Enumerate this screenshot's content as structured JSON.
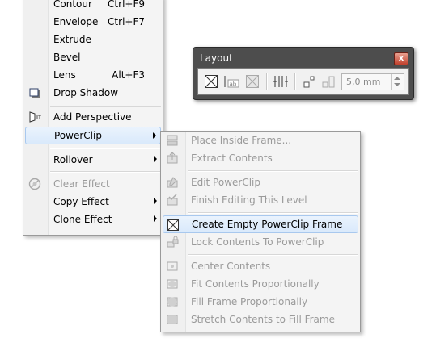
{
  "effects_menu": {
    "items": [
      {
        "label": "Contour",
        "shortcut": "Ctrl+F9"
      },
      {
        "label": "Envelope",
        "shortcut": "Ctrl+F7"
      },
      {
        "label": "Extrude"
      },
      {
        "label": "Bevel"
      },
      {
        "label": "Lens",
        "shortcut": "Alt+F3"
      },
      {
        "label": "Drop Shadow"
      },
      {
        "label": "Add Perspective"
      },
      {
        "label": "PowerClip"
      },
      {
        "label": "Rollover"
      },
      {
        "label": "Clear Effect"
      },
      {
        "label": "Copy Effect"
      },
      {
        "label": "Clone Effect"
      }
    ]
  },
  "layout_toolbar": {
    "title": "Layout",
    "close_glyph": "x",
    "spacing_value": "5,0 mm",
    "text_icon_label": "ab"
  },
  "powerclip_menu": {
    "items": [
      {
        "label": "Place Inside Frame..."
      },
      {
        "label": "Extract Contents"
      },
      {
        "label": "Edit PowerClip"
      },
      {
        "label": "Finish Editing This Level"
      },
      {
        "label": "Create Empty PowerClip Frame"
      },
      {
        "label": "Lock Contents To PowerClip"
      },
      {
        "label": "Center Contents"
      },
      {
        "label": "Fit Contents Proportionally"
      },
      {
        "label": "Fill Frame Proportionally"
      },
      {
        "label": "Stretch Contents to Fill Frame"
      }
    ]
  },
  "colors": {
    "highlight": "#d9e9fb",
    "disabled_text": "#9a9a9a",
    "toolbar_frame": "#4d4d4d"
  }
}
